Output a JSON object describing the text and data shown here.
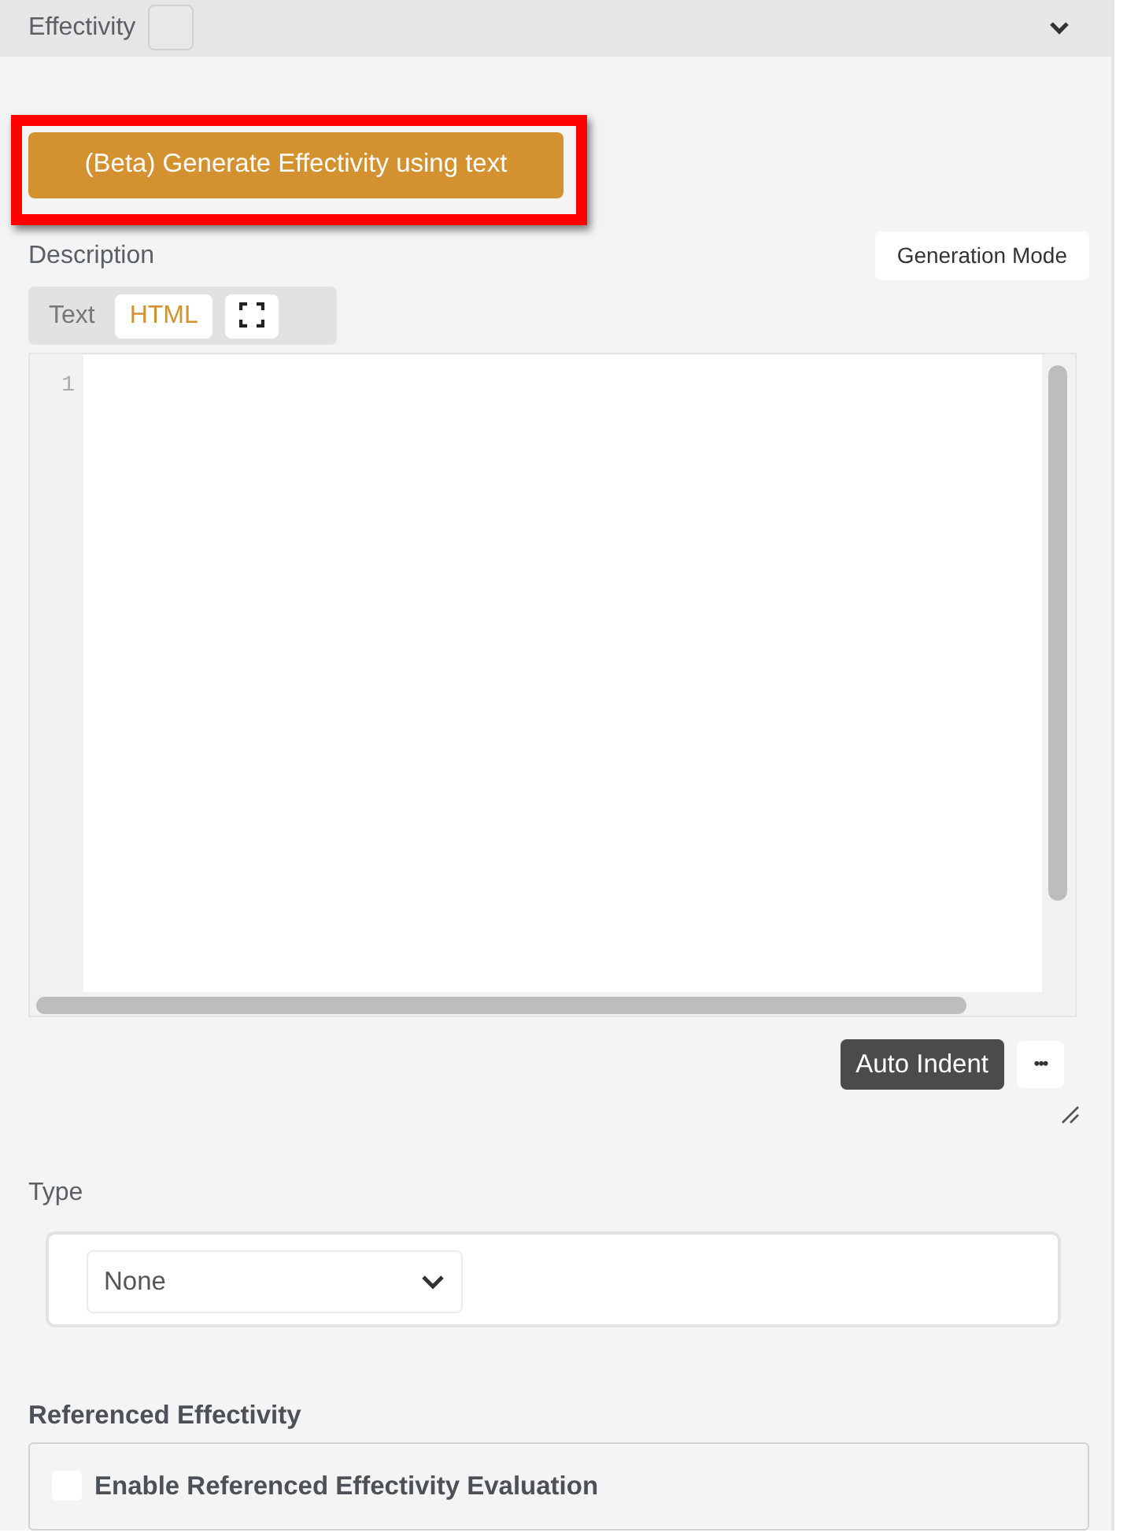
{
  "header": {
    "title": "Effectivity",
    "checkbox_checked": false,
    "expanded": true
  },
  "generate_button": {
    "label": "(Beta) Generate Effectivity using text",
    "highlighted": true
  },
  "description": {
    "label": "Description",
    "mode_button": "Generation Mode",
    "tabs": [
      {
        "label": "Text",
        "selected": false
      },
      {
        "label": "HTML",
        "selected": true
      }
    ],
    "editor": {
      "line_numbers": [
        "1"
      ]
    },
    "auto_indent": "Auto Indent",
    "more_button": "•••"
  },
  "type": {
    "label": "Type",
    "value": "None"
  },
  "referenced": {
    "label": "Referenced Effectivity",
    "option": {
      "label": "Enable Referenced Effectivity Evaluation",
      "checked": false
    }
  }
}
